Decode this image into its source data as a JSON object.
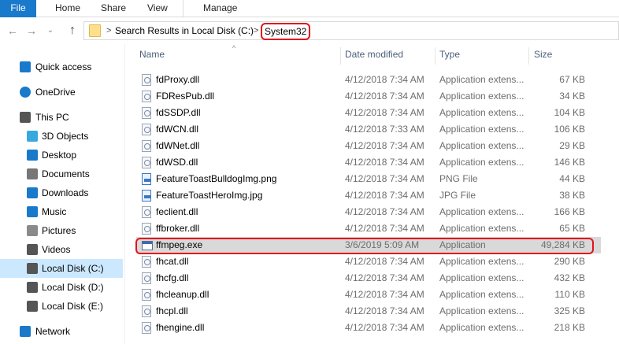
{
  "ribbon": {
    "tabs": [
      "File",
      "Home",
      "Share",
      "View",
      "Manage"
    ]
  },
  "nav": {
    "back_icon": "←",
    "forward_icon": "→",
    "recent_icon": "⌄",
    "up_icon": "↑",
    "crumbs": [
      "Search Results in Local Disk (C:)",
      "System32"
    ],
    "chevron": ">"
  },
  "sidebar": {
    "items": [
      {
        "label": "Quick access",
        "icon": "star-icon",
        "color": "#1979ca"
      },
      {
        "label": "OneDrive",
        "icon": "cloud-icon",
        "color": "#1979ca"
      },
      {
        "label": "This PC",
        "icon": "computer-icon",
        "color": "#555555"
      },
      {
        "label": "3D Objects",
        "icon": "cube-icon",
        "color": "#38a9e0"
      },
      {
        "label": "Desktop",
        "icon": "desktop-icon",
        "color": "#1979ca"
      },
      {
        "label": "Documents",
        "icon": "document-icon",
        "color": "#777777"
      },
      {
        "label": "Downloads",
        "icon": "download-icon",
        "color": "#1979ca"
      },
      {
        "label": "Music",
        "icon": "music-icon",
        "color": "#1979ca"
      },
      {
        "label": "Pictures",
        "icon": "pictures-icon",
        "color": "#8a8a8a"
      },
      {
        "label": "Videos",
        "icon": "film-icon",
        "color": "#555555"
      },
      {
        "label": "Local Disk (C:)",
        "icon": "drive-icon",
        "color": "#555555",
        "selected": true
      },
      {
        "label": "Local Disk (D:)",
        "icon": "drive-icon",
        "color": "#555555"
      },
      {
        "label": "Local Disk (E:)",
        "icon": "drive-icon",
        "color": "#555555"
      },
      {
        "label": "Network",
        "icon": "network-icon",
        "color": "#1979ca"
      }
    ]
  },
  "columns": {
    "name": "Name",
    "date": "Date modified",
    "type": "Type",
    "size": "Size"
  },
  "files": [
    {
      "name": "fdProxy.dll",
      "date": "4/12/2018 7:34 AM",
      "type": "Application extens...",
      "size": "67 KB",
      "icon": "dll"
    },
    {
      "name": "FDResPub.dll",
      "date": "4/12/2018 7:34 AM",
      "type": "Application extens...",
      "size": "34 KB",
      "icon": "dll"
    },
    {
      "name": "fdSSDP.dll",
      "date": "4/12/2018 7:34 AM",
      "type": "Application extens...",
      "size": "104 KB",
      "icon": "dll"
    },
    {
      "name": "fdWCN.dll",
      "date": "4/12/2018 7:33 AM",
      "type": "Application extens...",
      "size": "106 KB",
      "icon": "dll"
    },
    {
      "name": "fdWNet.dll",
      "date": "4/12/2018 7:34 AM",
      "type": "Application extens...",
      "size": "29 KB",
      "icon": "dll"
    },
    {
      "name": "fdWSD.dll",
      "date": "4/12/2018 7:34 AM",
      "type": "Application extens...",
      "size": "146 KB",
      "icon": "dll"
    },
    {
      "name": "FeatureToastBulldogImg.png",
      "date": "4/12/2018 7:34 AM",
      "type": "PNG File",
      "size": "44 KB",
      "icon": "img"
    },
    {
      "name": "FeatureToastHeroImg.jpg",
      "date": "4/12/2018 7:34 AM",
      "type": "JPG File",
      "size": "38 KB",
      "icon": "img"
    },
    {
      "name": "feclient.dll",
      "date": "4/12/2018 7:34 AM",
      "type": "Application extens...",
      "size": "166 KB",
      "icon": "dll"
    },
    {
      "name": "ffbroker.dll",
      "date": "4/12/2018 7:34 AM",
      "type": "Application extens...",
      "size": "65 KB",
      "icon": "dll"
    },
    {
      "name": "ffmpeg.exe",
      "date": "3/6/2019 5:09 AM",
      "type": "Application",
      "size": "49,284 KB",
      "icon": "exe",
      "highlighted": true
    },
    {
      "name": "fhcat.dll",
      "date": "4/12/2018 7:34 AM",
      "type": "Application extens...",
      "size": "290 KB",
      "icon": "dll"
    },
    {
      "name": "fhcfg.dll",
      "date": "4/12/2018 7:34 AM",
      "type": "Application extens...",
      "size": "432 KB",
      "icon": "dll"
    },
    {
      "name": "fhcleanup.dll",
      "date": "4/12/2018 7:34 AM",
      "type": "Application extens...",
      "size": "110 KB",
      "icon": "dll"
    },
    {
      "name": "fhcpl.dll",
      "date": "4/12/2018 7:34 AM",
      "type": "Application extens...",
      "size": "325 KB",
      "icon": "dll"
    },
    {
      "name": "fhengine.dll",
      "date": "4/12/2018 7:34 AM",
      "type": "Application extens...",
      "size": "218 KB",
      "icon": "dll"
    }
  ]
}
